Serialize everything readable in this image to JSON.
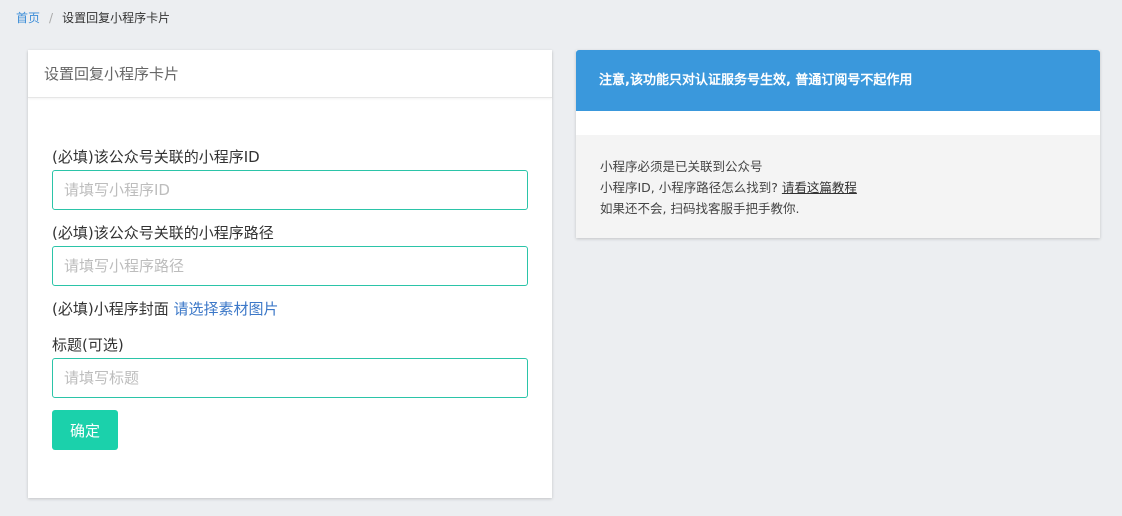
{
  "breadcrumb": {
    "home": "首页",
    "separator": "/",
    "current": "设置回复小程序卡片"
  },
  "form_panel": {
    "title": "设置回复小程序卡片",
    "appid": {
      "label": "(必填)该公众号关联的小程序ID",
      "placeholder": "请填写小程序ID",
      "value": ""
    },
    "path": {
      "label": "(必填)该公众号关联的小程序路径",
      "placeholder": "请填写小程序路径",
      "value": ""
    },
    "cover": {
      "label": "(必填)小程序封面",
      "link": "请选择素材图片"
    },
    "title_field": {
      "label": "标题(可选)",
      "placeholder": "请填写标题",
      "value": ""
    },
    "submit_label": "确定"
  },
  "info_panel": {
    "notice": "注意,该功能只对认证服务号生效, 普通订阅号不起作用",
    "line1": "小程序必须是已关联到公众号",
    "line2_prefix": "小程序ID, 小程序路径怎么找到? ",
    "line2_link": "请看这篇教程",
    "line3": "如果还不会, 扫码找客服手把手教你."
  },
  "colors": {
    "accent_teal": "#1bd1ab",
    "input_border": "#2bc4a8",
    "notice_blue": "#3a98dc",
    "link_blue": "#3c78c8",
    "background": "#eceef1"
  }
}
